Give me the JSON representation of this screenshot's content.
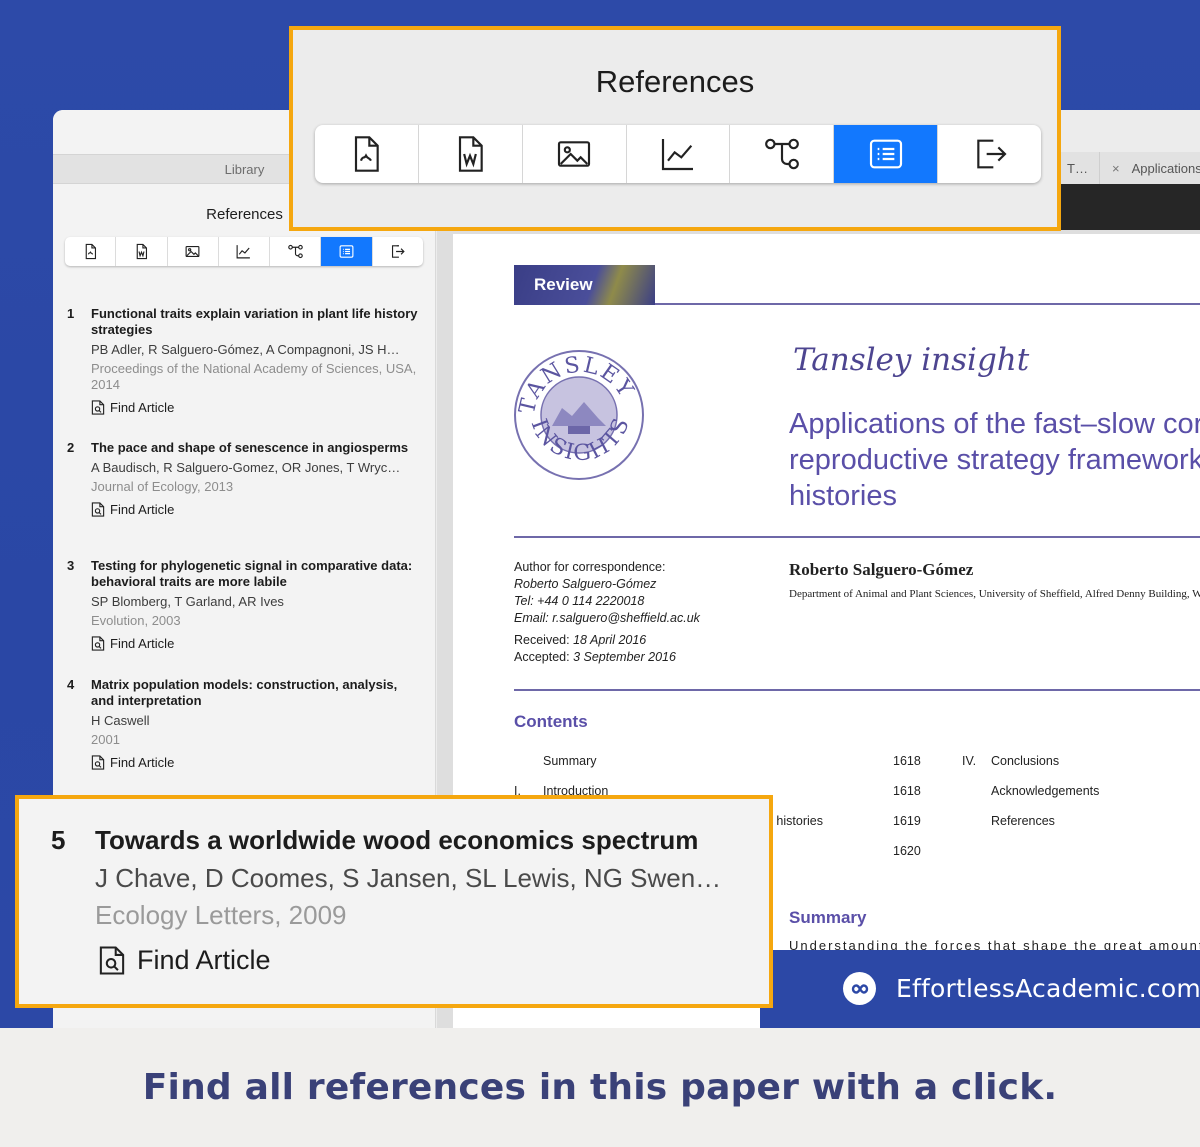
{
  "sidebar": {
    "library_tab": "Library",
    "title": "References",
    "toolbar": {
      "buttons": [
        "pdf-file-icon",
        "word-file-icon",
        "image-icon",
        "line-chart-icon",
        "workflow-icon",
        "list-icon",
        "export-icon"
      ],
      "active_index": 5
    },
    "references": [
      {
        "num": "1",
        "title": "Functional traits explain variation in plant life history strategies",
        "authors": "PB Adler, R Salguero-Gómez, A Compagnoni, JS H…",
        "journal": "Proceedings of the National Academy of Sciences, USA, 2014",
        "action": "Find Article"
      },
      {
        "num": "2",
        "title": "The pace and shape of senescence in angiosperms",
        "authors": "A Baudisch, R Salguero-Gomez, OR Jones, T Wryc…",
        "journal": "Journal of Ecology, 2013",
        "action": "Find Article"
      },
      {
        "num": "3",
        "title": "Testing for phylogenetic signal in comparative data: behavioral traits are more labile",
        "authors": "SP Blomberg, T Garland, AR Ives",
        "journal": "Evolution, 2003",
        "action": "Find Article"
      },
      {
        "num": "4",
        "title": "Matrix population models: construction, analysis, and interpretation",
        "authors": "H Caswell",
        "journal": "2001",
        "action": "Find Article"
      }
    ]
  },
  "tabs": {
    "tab1": "T…",
    "tab2": "Applications"
  },
  "document": {
    "badge": "Review",
    "series": "Tansley insight",
    "seal_top": "TANSLEY",
    "seal_bottom": "INSIGHTS",
    "title": "Applications of the fast–slow cor reproductive strategy framework histories",
    "correspondence_label": "Author for correspondence:",
    "correspondence_name": "Roberto Salguero-Gómez",
    "tel": "Tel: +44 0 114 2220018",
    "email": "Email: r.salguero@sheffield.ac.uk",
    "received_label": "Received: ",
    "received": "18 April 2016",
    "accepted_label": "Accepted: ",
    "accepted": "3 September 2016",
    "author": "Roberto Salguero-Gómez",
    "department": "Department of Animal and Plant Sciences, University of Sheffield, Alfred Denny Building, W",
    "contents_heading": "Contents",
    "toc_left": [
      {
        "num": "",
        "label": "Summary",
        "page": "1618"
      },
      {
        "num": "I.",
        "label": "Introduction",
        "page": "1618"
      },
      {
        "num": "",
        "label": "e histories",
        "page": "1619"
      },
      {
        "num": "",
        "label": "",
        "page": "1620"
      }
    ],
    "toc_right": [
      {
        "num": "IV.",
        "label": "Conclusions"
      },
      {
        "num": "",
        "label": "Acknowledgements"
      },
      {
        "num": "",
        "label": "References"
      }
    ],
    "summary_heading": "Summary",
    "summary_text": "Understanding the forces that shape the great amount of v"
  },
  "callout_toolbar": {
    "title": "References"
  },
  "callout_reference": {
    "num": "5",
    "title": "Towards a worldwide wood economics spectrum",
    "authors": "J Chave, D Coomes, S Jansen, SL Lewis, NG Swen…",
    "journal": "Ecology Letters, 2009",
    "action": "Find Article"
  },
  "brand": {
    "text": "EffortlessAcademic.com"
  },
  "caption": "Find all references in this paper with a click.",
  "colors": {
    "accent_blue": "#1278fe",
    "callout_border": "#f5a70f",
    "background_blue": "#2c48a6",
    "doc_purple": "#5a4fa8"
  }
}
